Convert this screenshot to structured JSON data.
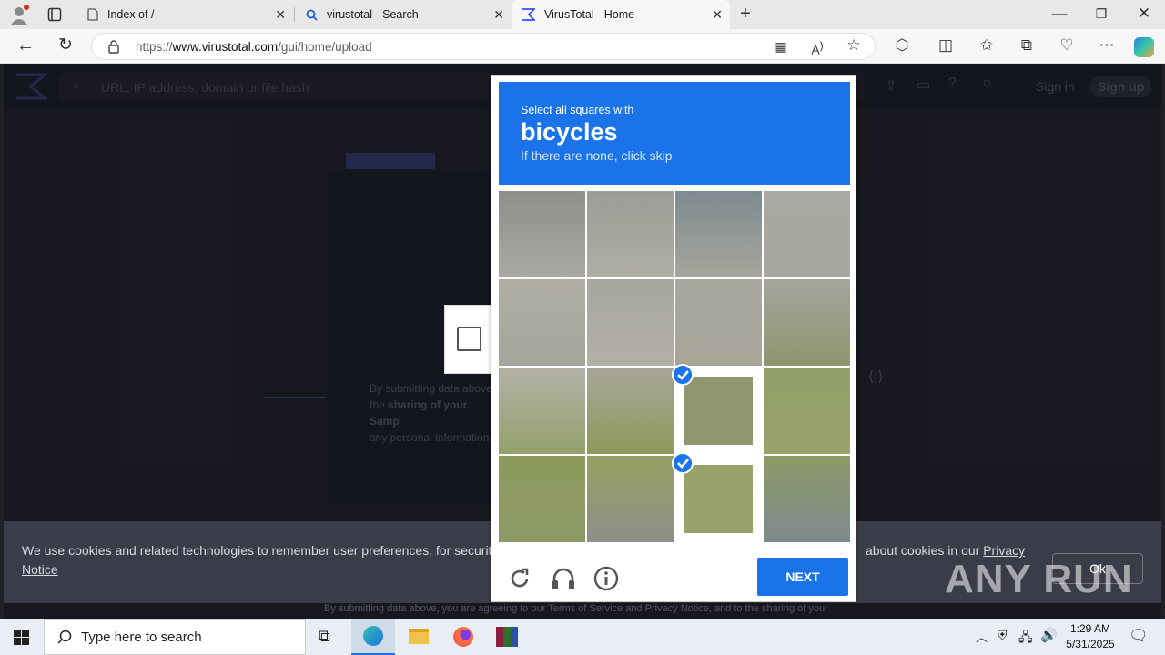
{
  "browser": {
    "tabs": [
      {
        "title": "Index of /",
        "icon": "file-icon"
      },
      {
        "title": "virustotal - Search",
        "icon": "search-icon"
      },
      {
        "title": "VirusTotal - Home",
        "icon": "virustotal-icon",
        "active": true
      }
    ],
    "url_prefix": "https://",
    "url_host": "www.virustotal.com",
    "url_path": "/gui/home/upload"
  },
  "vt": {
    "search_placeholder": "URL, IP address, domain or file hash",
    "sign_in": "Sign in",
    "sign_up": "Sign up",
    "bg_text_1": "By submitting data above,",
    "bg_text_2a": "the",
    "bg_text_2b": "sharing of your Samp",
    "bg_text_3": "any personal information,",
    "bottom_text": "By submitting data above, you are agreeing to our Terms of Service and Privacy Notice, and to the sharing of your"
  },
  "cookie": {
    "text_a": "We use cookies and related technologies to remember user preferences, for security, to",
    "text_b": "about cookies in our",
    "privacy": "Privacy",
    "notice": "Notice",
    "button": "Ok"
  },
  "captcha": {
    "instruction": "Select all squares with",
    "target": "bicycles",
    "hint": "If there are none, click skip",
    "next_label": "NEXT",
    "selected_cells": [
      10,
      14
    ]
  },
  "watermark": "ANY RUN",
  "taskbar": {
    "search_placeholder": "Type here to search",
    "time": "1:29 AM",
    "date": "5/31/2025"
  },
  "colors": {
    "captcha_blue": "#1a73e8",
    "vt_dark": "#2b2d3a"
  }
}
